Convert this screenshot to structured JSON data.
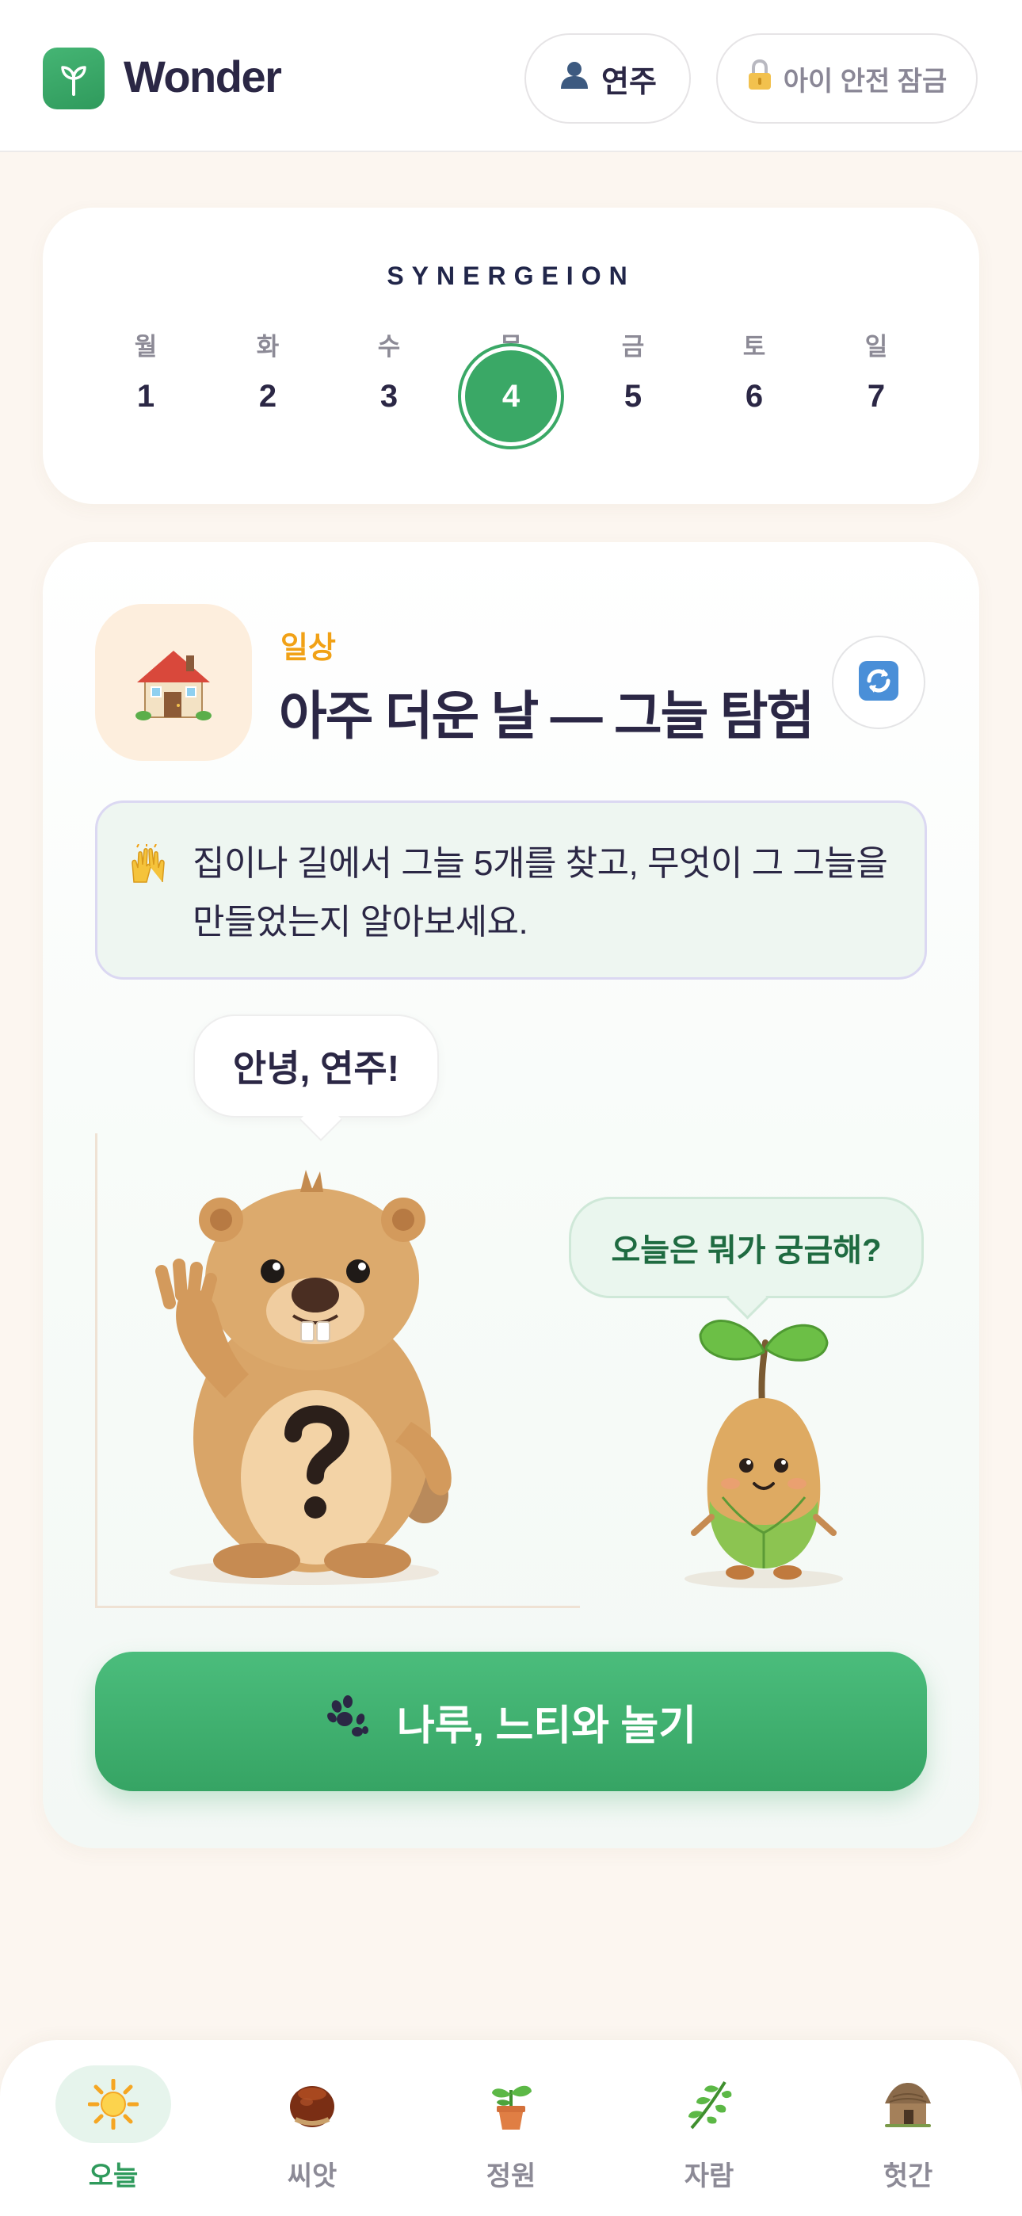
{
  "header": {
    "app_name": "Wonder",
    "profile_label": "연주",
    "lock_label": "아이 안전 잠금",
    "icons": {
      "logo": "sprout-icon",
      "profile": "person-icon",
      "lock": "lock-icon"
    }
  },
  "week": {
    "title": "SYNERGEION",
    "days": [
      {
        "label": "월",
        "num": "1"
      },
      {
        "label": "화",
        "num": "2"
      },
      {
        "label": "수",
        "num": "3"
      },
      {
        "label": "목",
        "num": "4"
      },
      {
        "label": "금",
        "num": "5"
      },
      {
        "label": "토",
        "num": "6"
      },
      {
        "label": "일",
        "num": "7"
      }
    ],
    "selected_index": 3
  },
  "topic": {
    "icon": "house-icon",
    "category": "일상",
    "title": "아주 더운 날 — 그늘 탐험",
    "refresh_icon": "refresh-icon"
  },
  "mission": {
    "icon": "raised-hands-icon",
    "text": "집이나 길에서 그늘 5개를 찾고, 무엇이 그 그늘을 만들었는지 알아보세요."
  },
  "characters": {
    "beaver_greeting": "안녕, 연주!",
    "sprout_question": "오늘은 뭐가 궁금해?"
  },
  "play_button": {
    "icon": "paw-icon",
    "label": "나루, 느티와 놀기"
  },
  "nav": {
    "items": [
      {
        "label": "오늘",
        "icon": "sun-icon",
        "active": true
      },
      {
        "label": "씨앗",
        "icon": "chestnut-icon",
        "active": false
      },
      {
        "label": "정원",
        "icon": "potted-plant-icon",
        "active": false
      },
      {
        "label": "자람",
        "icon": "herb-icon",
        "active": false
      },
      {
        "label": "헛간",
        "icon": "hut-icon",
        "active": false
      }
    ]
  },
  "colors": {
    "brand_green": "#3aa866",
    "accent_orange": "#f1a116",
    "text_dark": "#2b2745",
    "background": "#fcf6f0"
  }
}
